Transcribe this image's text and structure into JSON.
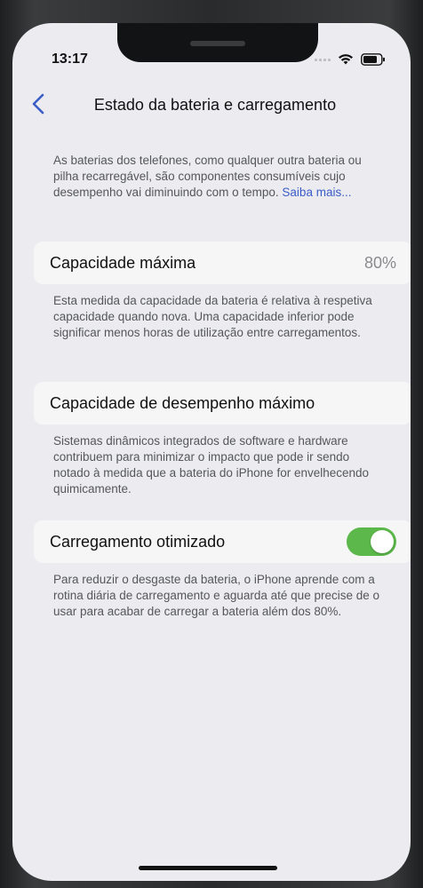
{
  "status_bar": {
    "time": "13:17"
  },
  "nav": {
    "title": "Estado da bateria e carregamento"
  },
  "intro": {
    "text": "As baterias dos telefones, como qualquer outra bateria ou pilha recarregável, são componentes consumíveis cujo desempenho vai diminuindo com o tempo.",
    "link_label": "Saiba mais..."
  },
  "max_capacity": {
    "label": "Capacidade máxima",
    "value": "80%",
    "description": "Esta medida da capacidade da bateria é relativa à respetiva capacidade quando nova. Uma capacidade inferior pode significar menos horas de utilização entre carregamentos."
  },
  "peak_performance": {
    "label": "Capacidade de desempenho máximo",
    "description": "Sistemas dinâmicos integrados de software e hardware contribuem para minimizar o impacto que pode ir sendo notado à medida que a bateria do iPhone for envelhecendo quimicamente."
  },
  "optimized_charging": {
    "label": "Carregamento otimizado",
    "enabled": true,
    "description": "Para reduzir o desgaste da bateria, o iPhone aprende com a rotina diária de carregamento e aguarda até que precise de o usar para acabar de carregar a bateria além dos 80%."
  },
  "colors": {
    "accent": "#3a5cc7",
    "toggle_on": "#5cb84a",
    "background": "#ebebf0"
  }
}
